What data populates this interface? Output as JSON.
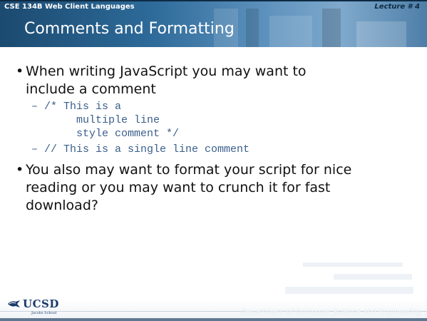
{
  "header": {
    "course": "CSE 134B  Web Client Languages",
    "lecture": "Lecture # 4",
    "title": "Comments and Formatting"
  },
  "body": {
    "bullet1": {
      "line1": "When writing JavaScript you may want to",
      "line2": "include a comment"
    },
    "code": {
      "multi_line1": "– /* This is a",
      "multi_line2": "       multiple line",
      "multi_line3": "       style comment */",
      "single_line": "– // This is a single line comment"
    },
    "bullet2": {
      "line1": "You also may want to format your script for nice",
      "line2": "reading or you may want to crunch it for fast",
      "line3": "download?"
    }
  },
  "footer": {
    "logo_text": "UCSD",
    "logo_sub": "Jacobs School",
    "department": "Department of Computer Science and Engineering"
  }
}
